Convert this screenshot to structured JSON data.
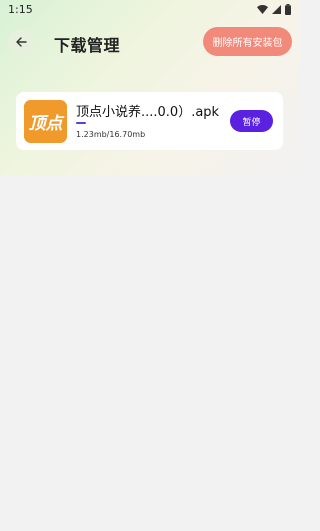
{
  "status_bar": {
    "time": "1:15",
    "icons": [
      "wifi-icon",
      "signal-icon",
      "battery-icon"
    ]
  },
  "header": {
    "title": "下载管理",
    "back_icon": "back-arrow-icon",
    "delete_all_label": "删除所有安装包"
  },
  "downloads": [
    {
      "name": "顶点小说养....0.0）.apk",
      "size_text": "1.23mb/16.70mb",
      "progress": 0.0737,
      "action_label": "暂停",
      "icon_text": "顶点"
    }
  ],
  "colors": {
    "accent": "#5a22e0",
    "delete_button": "#f28a7c",
    "app_icon": "#f09a2c",
    "background": "#f2f2f2"
  }
}
